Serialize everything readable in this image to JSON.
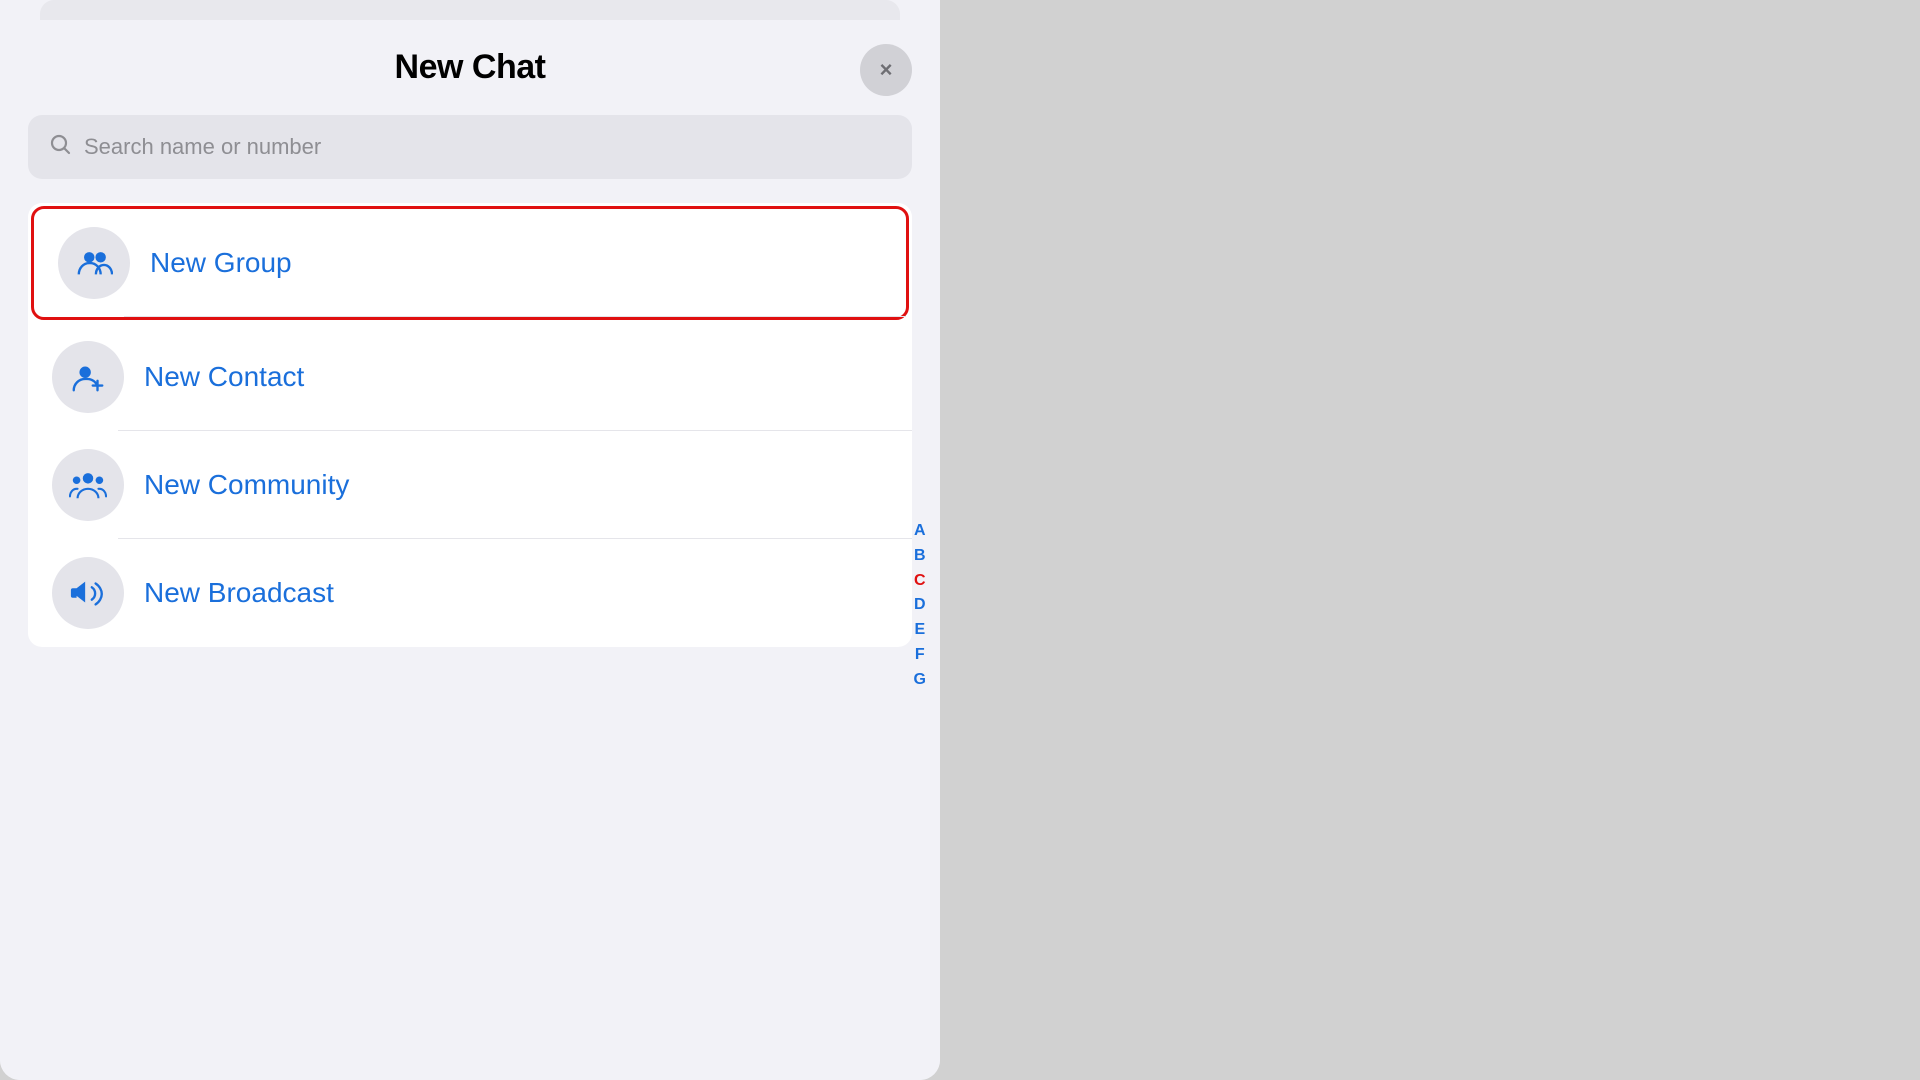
{
  "header": {
    "title": "New Chat",
    "close_button_label": "×"
  },
  "search": {
    "placeholder": "Search name or number"
  },
  "menu_items": [
    {
      "id": "new-group",
      "label": "New Group",
      "icon": "group",
      "highlighted": true
    },
    {
      "id": "new-contact",
      "label": "New Contact",
      "icon": "contact",
      "highlighted": false
    },
    {
      "id": "new-community",
      "label": "New Community",
      "icon": "community",
      "highlighted": false
    },
    {
      "id": "new-broadcast",
      "label": "New Broadcast",
      "icon": "broadcast",
      "highlighted": false
    }
  ],
  "alphabet": [
    "A",
    "B",
    "C",
    "D",
    "E",
    "F",
    "G"
  ],
  "colors": {
    "accent": "#1a6fdb",
    "highlight_border": "#e01010",
    "background": "#f2f2f7",
    "card_bg": "#ffffff",
    "icon_bg": "#e4e4ea",
    "search_bg": "#e4e4ea"
  }
}
